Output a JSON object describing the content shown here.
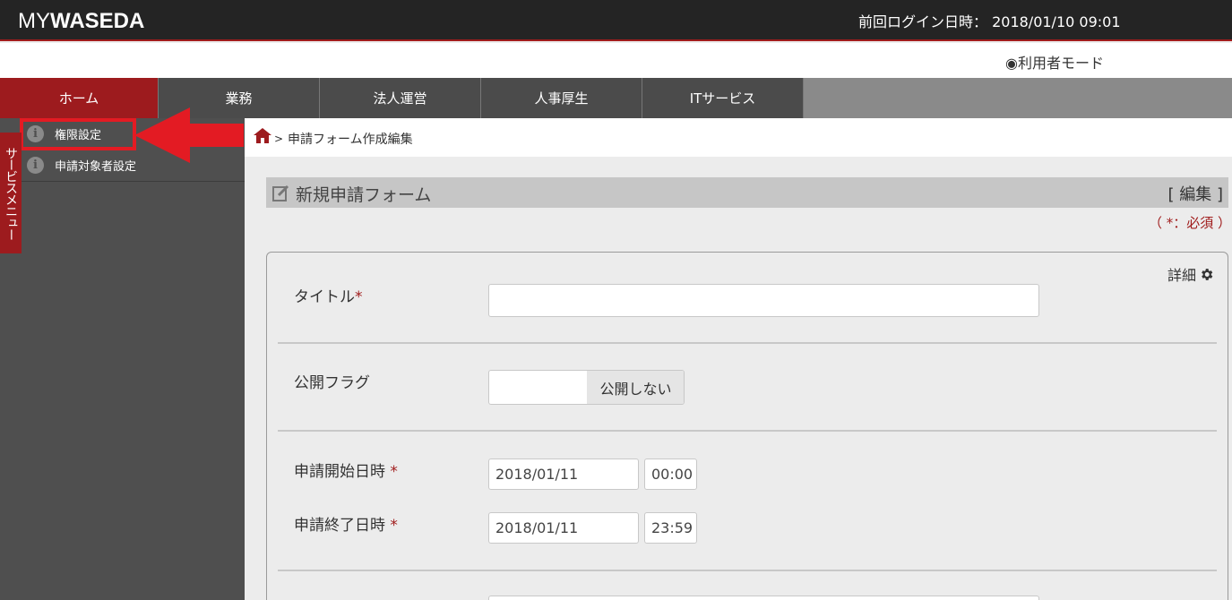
{
  "header": {
    "logo_my": "MY",
    "logo_brand": "WASEDA",
    "last_login": "前回ログイン日時： 2018/01/10 09:01",
    "mode": "◉利用者モード"
  },
  "nav": {
    "tabs": [
      {
        "label": "ホーム"
      },
      {
        "label": "業務"
      },
      {
        "label": "法人運営"
      },
      {
        "label": "人事厚生"
      },
      {
        "label": "ITサービス"
      }
    ]
  },
  "sidebar": {
    "vertical_tab": "サービスメニュー",
    "items": [
      {
        "label": "権限設定"
      },
      {
        "label": "申請対象者設定"
      }
    ]
  },
  "breadcrumb": {
    "separator": ">",
    "current": "申請フォーム作成編集"
  },
  "section": {
    "title": "新規申請フォーム",
    "edit_link": "[ 編集 ]",
    "required_note": "（ *：必須 ）"
  },
  "form": {
    "detail_label": "詳細",
    "title_label": "タイトル",
    "title_value": "",
    "publish_label": "公開フラグ",
    "publish_value": "公開しない",
    "start_label": "申請開始日時",
    "start_date": "2018/01/11",
    "start_time": "00:00",
    "end_label": "申請終了日時",
    "end_date": "2018/01/11",
    "end_time": "23:59",
    "required_mark": "*"
  },
  "colors": {
    "brand_red": "#9d1b1e",
    "highlight_red": "#e31b23",
    "header_bg": "#242424",
    "sidebar_bg": "#4f4f4f"
  }
}
